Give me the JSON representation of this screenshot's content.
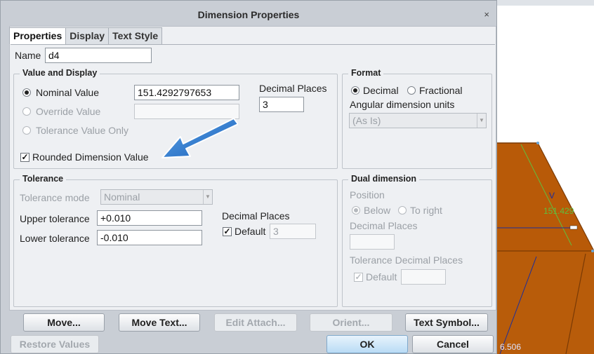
{
  "dialog": {
    "title": "Dimension Properties",
    "close_glyph": "×"
  },
  "tabs": [
    {
      "label": "Properties",
      "active": true
    },
    {
      "label": "Display",
      "active": false
    },
    {
      "label": "Text Style",
      "active": false
    }
  ],
  "name": {
    "label": "Name",
    "value": "d4"
  },
  "value_display": {
    "title": "Value and Display",
    "nominal_label": "Nominal Value",
    "nominal_value": "151.4292797653",
    "override_label": "Override Value",
    "override_value": "",
    "tol_only_label": "Tolerance Value Only",
    "rounded_label": "Rounded Dimension Value",
    "rounded_checked": true,
    "decimal_places_label": "Decimal Places",
    "decimal_places_value": "3"
  },
  "format": {
    "title": "Format",
    "decimal_label": "Decimal",
    "fractional_label": "Fractional",
    "angular_label": "Angular dimension units",
    "angular_value": "(As Is)"
  },
  "tolerance": {
    "title": "Tolerance",
    "mode_label": "Tolerance mode",
    "mode_value": "Nominal",
    "upper_label": "Upper tolerance",
    "upper_value": "+0.010",
    "lower_label": "Lower tolerance",
    "lower_value": "-0.010",
    "decimal_places_label": "Decimal Places",
    "default_label": "Default",
    "default_value": "3"
  },
  "dual": {
    "title": "Dual dimension",
    "position_label": "Position",
    "below_label": "Below",
    "to_right_label": "To right",
    "decimal_places_label": "Decimal Places",
    "tol_decimal_label": "Tolerance Decimal Places",
    "default_label": "Default"
  },
  "buttons": {
    "move": "Move...",
    "move_text": "Move Text...",
    "edit_attach": "Edit Attach...",
    "orient": "Orient...",
    "text_symbol": "Text Symbol...",
    "restore": "Restore Values",
    "ok": "OK",
    "cancel": "Cancel"
  },
  "cad": {
    "dim_label_v": "V",
    "dim_value_top": "151.429",
    "dim_value_bottom": "6.506",
    "colors": {
      "body": "#c8650a",
      "edge": "#7a3a05",
      "dim_green": "#5fbf3f",
      "dim_blue": "#1c2e9c"
    }
  },
  "annotation": {
    "arrow_color": "#1d6fc7"
  }
}
